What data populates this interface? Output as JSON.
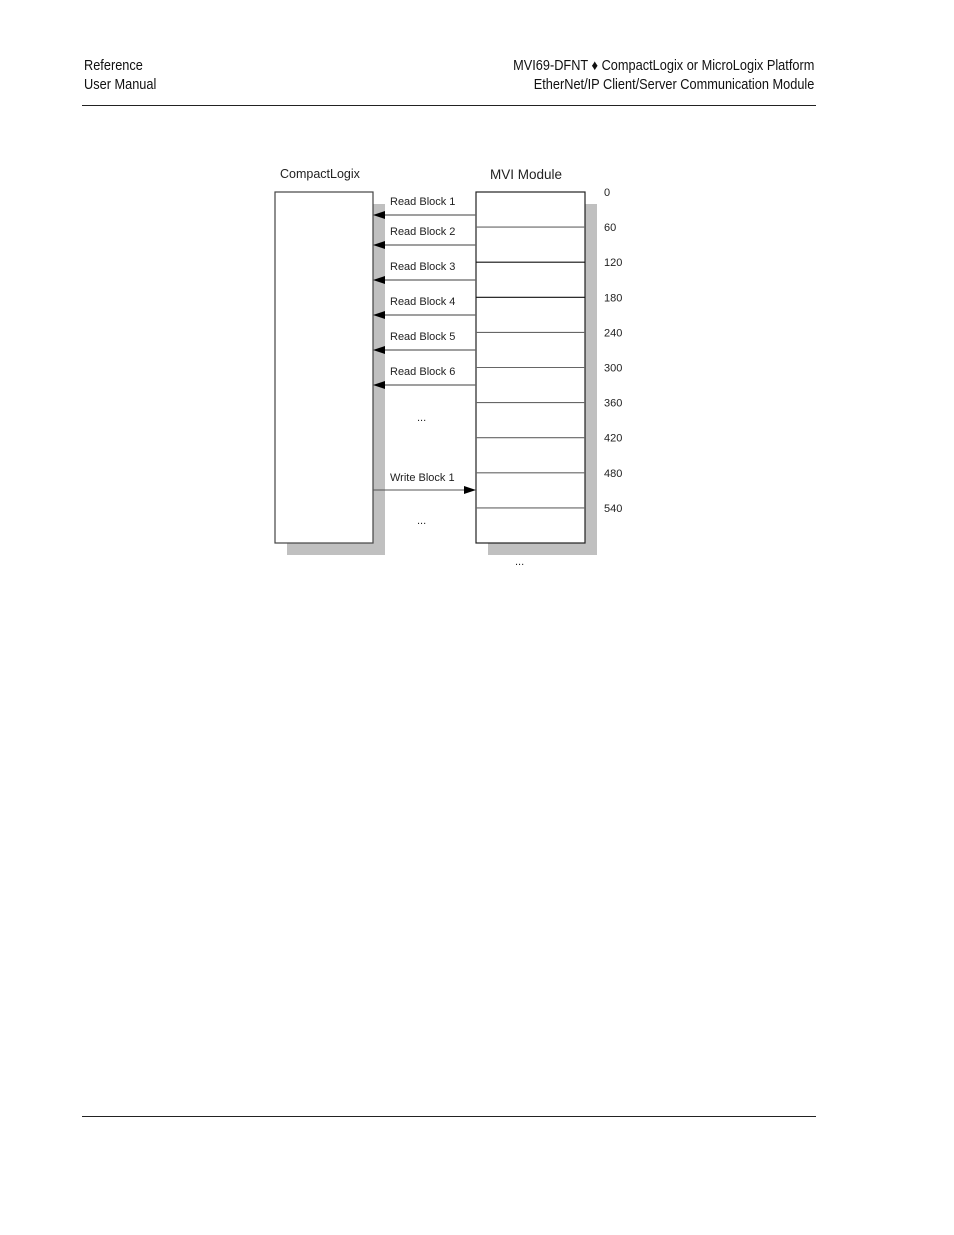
{
  "header": {
    "left_line1": "Reference",
    "left_line2": "User Manual",
    "right_line1": "MVI69-DFNT ♦ CompactLogix or MicroLogix Platform",
    "right_line2": "EtherNet/IP Client/Server Communication Module"
  },
  "diagram": {
    "left_box_title": "CompactLogix",
    "right_box_title": "MVI Module",
    "offsets": [
      "0",
      "60",
      "120",
      "180",
      "240",
      "300",
      "360",
      "420",
      "480",
      "540"
    ],
    "read_blocks": [
      "Read Block 1",
      "Read Block 2",
      "Read Block 3",
      "Read Block 4",
      "Read Block 5",
      "Read Block 6"
    ],
    "read_ellipsis": "...",
    "write_blocks": [
      "Write Block 1"
    ],
    "write_ellipsis": "...",
    "module_ellipsis": "...",
    "colors": {
      "shadow": "#c0c0c0",
      "line": "#333333",
      "arrow": "#000000"
    }
  }
}
